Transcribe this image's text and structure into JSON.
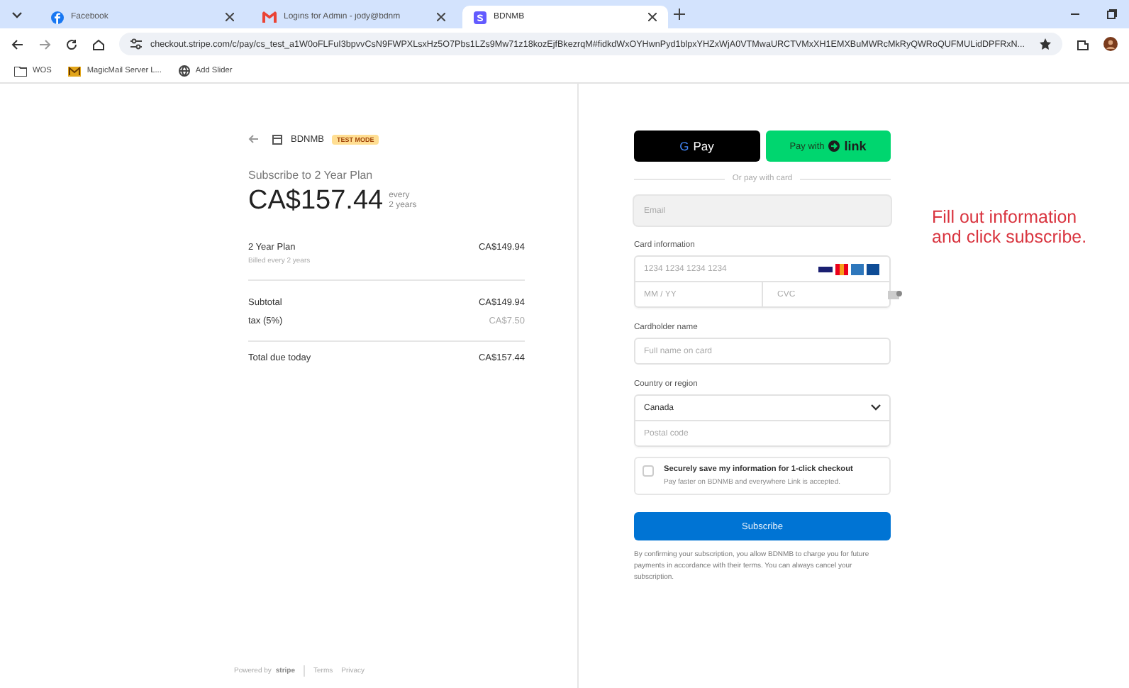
{
  "browser": {
    "tabs": [
      {
        "title": "Facebook",
        "kind": "facebook",
        "selected": false
      },
      {
        "title": "Logins for Admin - jody@bdnm",
        "kind": "mail",
        "selected": false
      },
      {
        "title": "BDNMB",
        "kind": "stripe",
        "selected": true
      }
    ],
    "url": "checkout.stripe.com/c/pay/cs_test_a1W0oFLFuI3bpvvCsN9FWPXLsxHz5O7Pbs1LZs9Mw71z18kozEjfBkezrqM#fidkdWxOYHwnPyd1blpxYHZxWjA0VTMwaURCTVMxXH1EMXBuMWRcMkRyQWRoQUFMULidDPFRxN...",
    "bookmarks": [
      {
        "label": "WOS",
        "kind": "folder"
      },
      {
        "label": "MagicMail Server L...",
        "kind": "app"
      },
      {
        "label": "Add Slider",
        "kind": "globe"
      }
    ]
  },
  "summary": {
    "merchant": "BDNMB",
    "badge": "TEST MODE",
    "plan_title": "Subscribe to 2 Year Plan",
    "price": "CA$157.44",
    "period": [
      "every",
      "2 years"
    ],
    "item": {
      "name": "2 Year Plan",
      "note": "Billed every 2 years",
      "amount": "CA$149.94"
    },
    "rows": [
      {
        "label": "Subtotal",
        "amount": "CA$149.94",
        "muted": false
      },
      {
        "label": "tax (5%)",
        "amount": "CA$7.50",
        "muted": true
      }
    ],
    "total": {
      "label": "Total due today",
      "amount": "CA$157.44"
    },
    "footer": {
      "powered": "Powered by",
      "brand": "stripe",
      "links": [
        "Terms",
        "Privacy"
      ]
    }
  },
  "form": {
    "gpay": {
      "g": "G",
      "label": "Pay"
    },
    "link_button": {
      "prefix": "Pay with",
      "label": "link"
    },
    "divider": "Or pay with card",
    "email": {
      "placeholder": "Email"
    },
    "card": {
      "label": "Card information",
      "number": {
        "placeholder": "1234 1234 1234 1234"
      },
      "expiry": {
        "placeholder": "MM / YY"
      },
      "cvc": {
        "placeholder": "CVC"
      }
    },
    "cardholder": {
      "label": "Cardholder name",
      "placeholder": "Full name on card"
    },
    "country": {
      "label": "Country or region",
      "value": "Canada",
      "postal": {
        "placeholder": "Postal code"
      }
    },
    "save": {
      "checked": false,
      "title": "Securely save my information for 1-click checkout",
      "note": "Pay faster on BDNMB and everywhere Link is accepted."
    },
    "submit": "Subscribe",
    "legal": "By confirming your subscription, you allow BDNMB to charge you for future payments in accordance with their terms. You can always cancel your subscription."
  },
  "annotation": "Fill out information and click subscribe."
}
